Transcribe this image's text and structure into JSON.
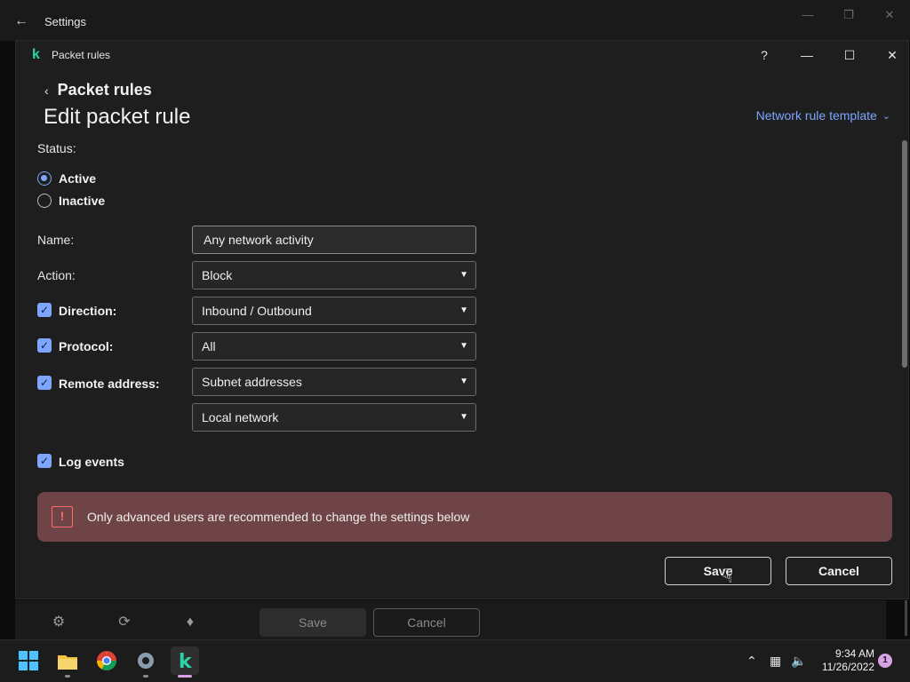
{
  "outer_window": {
    "title": "Settings"
  },
  "dialog": {
    "title": "Packet rules",
    "help_label": "?",
    "breadcrumb": "Packet rules",
    "heading": "Edit packet rule",
    "template_link": "Network rule template"
  },
  "form": {
    "status_label": "Status:",
    "status_options": [
      {
        "label": "Active",
        "selected": true
      },
      {
        "label": "Inactive",
        "selected": false
      }
    ],
    "name_label": "Name:",
    "name_value": "Any network activity",
    "action_label": "Action:",
    "action_value": "Block",
    "direction_label": "Direction:",
    "direction_value": "Inbound / Outbound",
    "protocol_label": "Protocol:",
    "protocol_value": "All",
    "remote_label": "Remote address:",
    "remote_value": "Subnet addresses",
    "remote_value2": "Local network",
    "log_label": "Log events",
    "checks": {
      "direction": true,
      "protocol": true,
      "remote": true,
      "log": true
    }
  },
  "warning": {
    "text": "Only advanced users are recommended to change the settings below"
  },
  "buttons": {
    "save": "Save",
    "cancel": "Cancel"
  },
  "footer": {
    "save": "Save",
    "cancel": "Cancel"
  },
  "taskbar": {
    "time": "9:34 AM",
    "date": "11/26/2022",
    "notification_count": "1"
  },
  "colors": {
    "accent": "#7ea6ff",
    "warning_bg": "#6f4446",
    "brand": "#28d3a4"
  }
}
